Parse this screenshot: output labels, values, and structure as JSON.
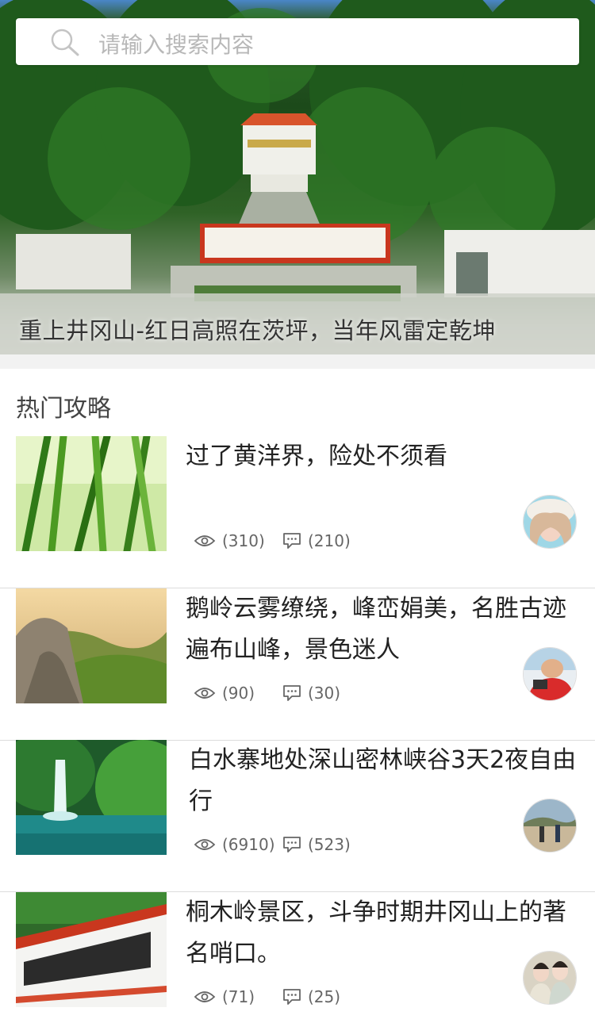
{
  "search": {
    "placeholder": "请输入搜索内容"
  },
  "hero": {
    "caption": "重上井冈山-红日高照在茨坪，当年风雷定乾坤"
  },
  "section": {
    "title": "热门攻略"
  },
  "articles": [
    {
      "title": "过了黄洋界，险处不须看",
      "views": "(310)",
      "comments": "(210)"
    },
    {
      "title": "鹅岭云雾缭绕，峰峦娟美，名胜古迹遍布山峰，景色迷人",
      "views": "(90)",
      "comments": "(30)"
    },
    {
      "title": "白水寨地处深山密林峡谷3天2夜自由行",
      "views": "(6910)",
      "comments": "(523)"
    },
    {
      "title": "桐木岭景区，斗争时期井冈山上的著名哨口。",
      "views": "(71)",
      "comments": "(25)"
    }
  ],
  "icons": {
    "views": "eye-icon",
    "comments": "comment-icon",
    "search": "search-icon"
  },
  "colors": {
    "text": "#222222",
    "stat": "#666666",
    "divider": "#dcdcdc",
    "placeholder": "#b8b8b8"
  }
}
